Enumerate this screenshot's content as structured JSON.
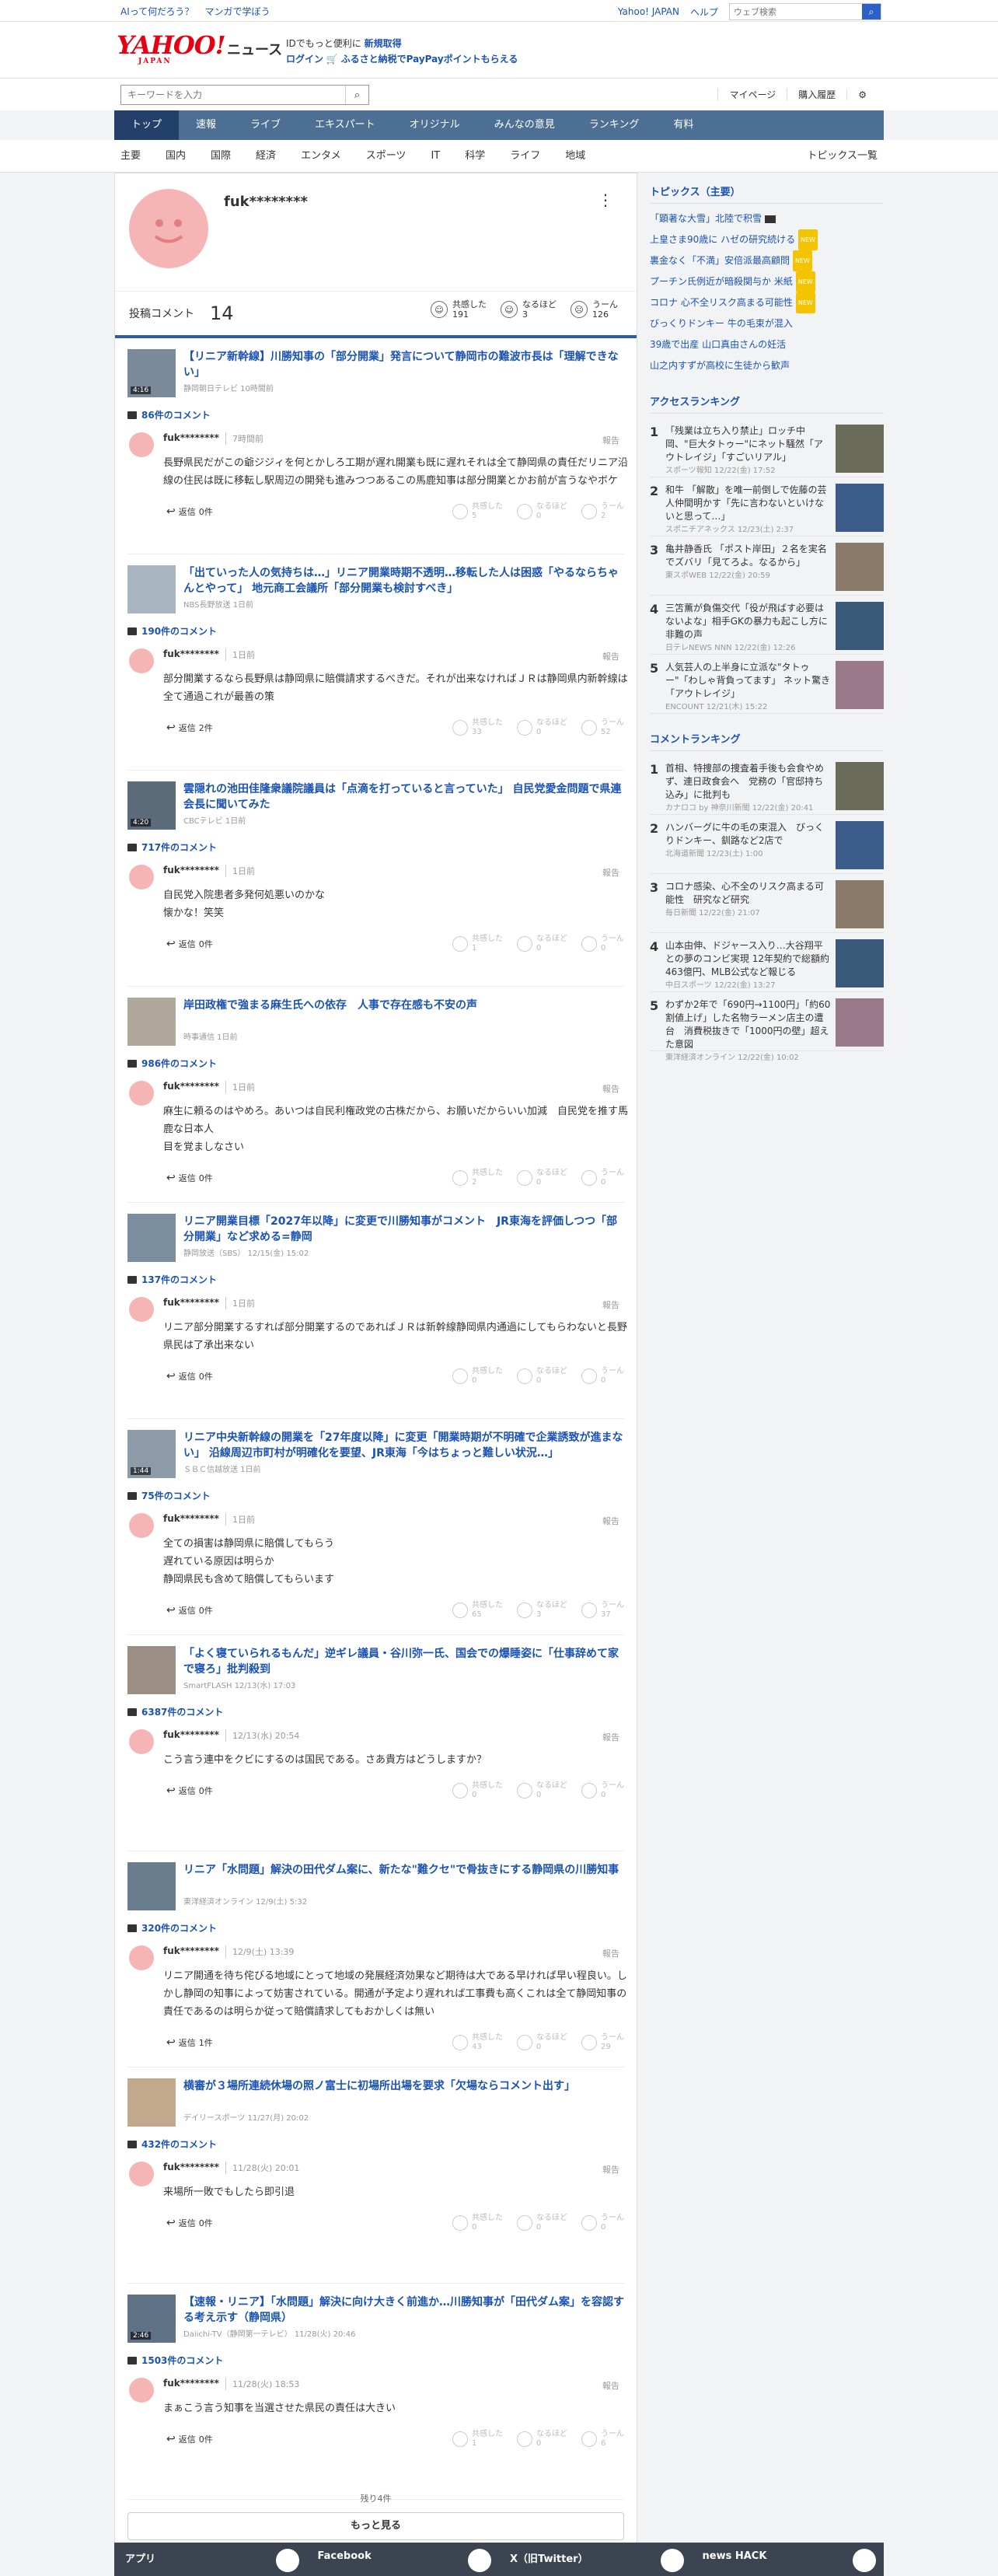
{
  "topbar": {
    "l1": "AIって何だろう？",
    "l2": "マンガで学ぼう",
    "r1": "Yahoo! JAPAN",
    "r2": "ヘルプ",
    "search_placeholder": "ウェブ検索"
  },
  "header": {
    "logo": "YAHOO!",
    "logo_sub": "JAPAN",
    "service": "ニュース",
    "promo1a": "IDでもっと便利に",
    "promo1b": "新規取得",
    "promo2a": "ログイン",
    "promo2b": "ふるさと納税でPayPayポイントもらえる"
  },
  "search": {
    "placeholder": "キーワードを入力",
    "mypage": "マイページ",
    "history": "購入履歴"
  },
  "gnav": [
    "トップ",
    "速報",
    "ライブ",
    "エキスパート",
    "オリジナル",
    "みんなの意見",
    "ランキング",
    "有料"
  ],
  "subnav": [
    "主要",
    "国内",
    "国際",
    "経済",
    "エンタメ",
    "スポーツ",
    "IT",
    "科学",
    "ライフ",
    "地域"
  ],
  "subnav_more": "トピックス一覧",
  "profile": {
    "name": "fuk********",
    "comments_label": "投稿コメント",
    "comments_count": "14",
    "empathy_label": "共感した",
    "empathy": "191",
    "naruhodo_label": "なるほど",
    "naruhodo": "3",
    "uun_label": "うーん",
    "uun": "126"
  },
  "labels": {
    "report": "報告",
    "reply": "返信",
    "empathy": "共感した",
    "naruhodo": "なるほど",
    "uun": "うーん"
  },
  "items": [
    {
      "title": "【リニア新幹線】川勝知事の「部分開業」発言について静岡市の難波市長は「理解できない」",
      "src": "静岡朝日テレビ 10時間前",
      "dur": "4:16",
      "ccount": "86件のコメント",
      "user": "fuk********",
      "time": "7時間前",
      "body": "長野県民だがこの爺ジジィを何とかしろ工期が遅れ開業も既に遅れそれは全て静岡県の責任だリニア沿線の住民は既に移転し駅周辺の開発も進みつつあるこの馬鹿知事は部分開業とかお前が言うなやボケ",
      "replies": "0件",
      "e": "5",
      "n": "0",
      "u": "2"
    },
    {
      "title": "「出ていった人の気持ちは…」リニア開業時期不透明…移転した人は困惑「やるならちゃんとやって」 地元商工会議所「部分開業も検討すべき」",
      "src": "NBS長野放送 1日前",
      "dur": "",
      "ccount": "190件のコメント",
      "user": "fuk********",
      "time": "1日前",
      "body": "部分開業するなら長野県は静岡県に賠償請求するべきだ。それが出来なければＪＲは静岡県内新幹線は全て通過これが最善の策",
      "replies": "2件",
      "e": "33",
      "n": "0",
      "u": "52"
    },
    {
      "title": "雲隠れの池田佳隆衆議院議員は「点滴を打っていると言っていた」 自民党愛金問題で県連会長に聞いてみた",
      "src": "CBCテレビ 1日前",
      "dur": "4:20",
      "ccount": "717件のコメント",
      "user": "fuk********",
      "time": "1日前",
      "body": "自民党入院患者多発何処悪いのかな\n懐かな！笑笑",
      "replies": "0件",
      "e": "1",
      "n": "0",
      "u": "0"
    },
    {
      "title": "岸田政権で強まる麻生氏への依存　人事で存在感も不安の声",
      "src": "時事通信 1日前",
      "dur": "",
      "ccount": "986件のコメント",
      "user": "fuk********",
      "time": "1日前",
      "body": "麻生に頼るのはやめろ。あいつは自民利権政党の古株だから、お願いだからいい加減　自民党を推す馬鹿な日本人\n目を覚ましなさい",
      "replies": "0件",
      "e": "2",
      "n": "0",
      "u": "0"
    },
    {
      "title": "リニア開業目標「2027年以降」に変更で川勝知事がコメント　JR東海を評価しつつ「部分開業」など求める=静岡",
      "src": "静岡放送（SBS） 12/15(金) 15:02",
      "dur": "",
      "ccount": "137件のコメント",
      "user": "fuk********",
      "time": "1日前",
      "body": "リニア部分開業するすれば部分開業するのであればＪＲは新幹線静岡県内通過にしてもらわないと長野県民は了承出来ない",
      "replies": "0件",
      "e": "0",
      "n": "0",
      "u": "0"
    },
    {
      "title": "リニア中央新幹線の開業を「27年度以降」に変更「開業時期が不明確で企業誘致が進まない」 沿線周辺市町村が明確化を要望、JR東海「今はちょっと難しい状況…」",
      "src": "ＳＢＣ信越放送 1日前",
      "dur": "1:44",
      "ccount": "75件のコメント",
      "user": "fuk********",
      "time": "1日前",
      "body": "全ての損害は静岡県に賠償してもらう\n遅れている原因は明らか\n静岡県民も含めて賠償してもらいます",
      "replies": "0件",
      "e": "65",
      "n": "3",
      "u": "37"
    },
    {
      "title": "「よく寝ていられるもんだ」逆ギレ議員・谷川弥一氏、国会での爆睡姿に「仕事辞めて家で寝ろ」批判殺到",
      "src": "SmartFLASH 12/13(水) 17:03",
      "dur": "",
      "ccount": "6387件のコメント",
      "user": "fuk********",
      "time": "12/13(水) 20:54",
      "body": "こう言う連中をクビにするのは国民である。さあ貴方はどうしますか？",
      "replies": "0件",
      "e": "0",
      "n": "0",
      "u": "0"
    },
    {
      "title": "リニア「水問題」解決の田代ダム案に、新たな\"難クセ\"で骨抜きにする静岡県の川勝知事",
      "src": "東洋経済オンライン 12/9(土) 5:32",
      "dur": "",
      "ccount": "320件のコメント",
      "user": "fuk********",
      "time": "12/9(土) 13:39",
      "body": "リニア開通を待ち侘びる地域にとって地域の発展経済効果など期待は大である早ければ早い程良い。しかし静岡の知事によって妨害されている。開通が予定より遅れれば工事費も高くこれは全て静岡知事の責任であるのは明らか従って賠償請求してもおかしくは無い",
      "replies": "1件",
      "e": "43",
      "n": "0",
      "u": "29"
    },
    {
      "title": "横審が３場所連続休場の照ノ富士に初場所出場を要求「欠場ならコメント出す」",
      "src": "デイリースポーツ 11/27(月) 20:02",
      "dur": "",
      "ccount": "432件のコメント",
      "user": "fuk********",
      "time": "11/28(火) 20:01",
      "body": "来場所一敗でもしたら即引退",
      "replies": "0件",
      "e": "0",
      "n": "0",
      "u": "0"
    },
    {
      "title": "【速報・リニア】「水問題」解決に向け大きく前進か…川勝知事が「田代ダム案」を容認する考え示す（静岡県）",
      "src": "Daiichi-TV（静岡第一テレビ） 11/28(火) 20:46",
      "dur": "2:46",
      "ccount": "1503件のコメント",
      "user": "fuk********",
      "time": "11/28(火) 18:53",
      "body": "まぁこう言う知事を当選させた県民の責任は大きい",
      "replies": "0件",
      "e": "1",
      "n": "0",
      "u": "6"
    }
  ],
  "more": {
    "rest": "残り4件",
    "button": "もっと見る"
  },
  "side": {
    "topics_title": "トピックス（主要）",
    "topics": [
      {
        "t": "「顕著な大雪」北陸で积雪",
        "tag": "cam"
      },
      {
        "t": "上皇さま90歳に ハゼの研究続ける",
        "tag": "NEW"
      },
      {
        "t": "裏金なく「不満」安倍派最高顧問",
        "tag": "NEW"
      },
      {
        "t": "プーチン氏例近が暗殺関与か 米紙",
        "tag": "NEW"
      },
      {
        "t": "コロナ 心不全リスク高まる可能性",
        "tag": "NEW"
      },
      {
        "t": "びっくりドンキー 牛の毛束が混入",
        "tag": ""
      },
      {
        "t": "39歳で出産 山口真由さんの妊活",
        "tag": ""
      },
      {
        "t": "山之内すずが高校に生徒から歓声",
        "tag": ""
      }
    ],
    "access_title": "アクセスランキング",
    "access": [
      {
        "n": "1",
        "t": "「残業は立ち入り禁止」ロッチ中岡、\"巨大タトゥー\"にネット騒然「アウトレイジ」「すごいリアル」",
        "s": "スポーツ報知 12/22(金) 17:52"
      },
      {
        "n": "2",
        "t": "和牛 「解散」を唯一前倒しで佐藤の芸人仲間明かす「先に言わないといけないと思って…」",
        "s": "スポニチアネックス 12/23(土) 2:37"
      },
      {
        "n": "3",
        "t": "亀井静香氏 「ポスト岸田」２名を実名でズバリ「見てろよ。なるから」",
        "s": "東スポWEB 12/22(金) 20:59"
      },
      {
        "n": "4",
        "t": "三笘薫が負傷交代「役が飛ばす必要はないよな」相手GKの暴力も起こし方に非難の声",
        "s": "日テレNEWS NNN 12/22(金) 12:26"
      },
      {
        "n": "5",
        "t": "人気芸人の上半身に立派な\"タトゥー\"「わしゃ背負ってます」 ネット驚き「アウトレイジ」",
        "s": "ENCOUNT 12/21(木) 15:22"
      }
    ],
    "comment_title": "コメントランキング",
    "comment": [
      {
        "n": "1",
        "t": "首相、特捜部の捜査着手後も会食やめず、連日政食会へ　党務の「官邸持ち込み」に批判も",
        "s": "カナロコ by 神奈川新聞 12/22(金) 20:41"
      },
      {
        "n": "2",
        "t": "ハンバーグに牛の毛の束混入　びっくりドンキー、釧路など2店で",
        "s": "北海道新聞 12/23(土) 1:00"
      },
      {
        "n": "3",
        "t": "コロナ感染、心不全のリスク高まる可能性　研究など研究",
        "s": "毎日新聞 12/22(金) 21:07"
      },
      {
        "n": "4",
        "t": "山本由伸、ドジャース入り…大谷翔平との夢のコンビ実現 12年契約で総額約463億円、MLB公式など報じる",
        "s": "中日スポーツ 12/22(金) 13:27"
      },
      {
        "n": "5",
        "t": "わずか2年で「690円→1100円」「約60割値上げ」した名物ラーメン店主の遭台　消費税抜きで「1000円の壁」超えた意図",
        "s": "東洋経済オンライン 12/22(金) 10:02"
      }
    ]
  },
  "footer": [
    "アプリ",
    "Facebook",
    "X（旧Twitter）",
    "news HACK"
  ]
}
